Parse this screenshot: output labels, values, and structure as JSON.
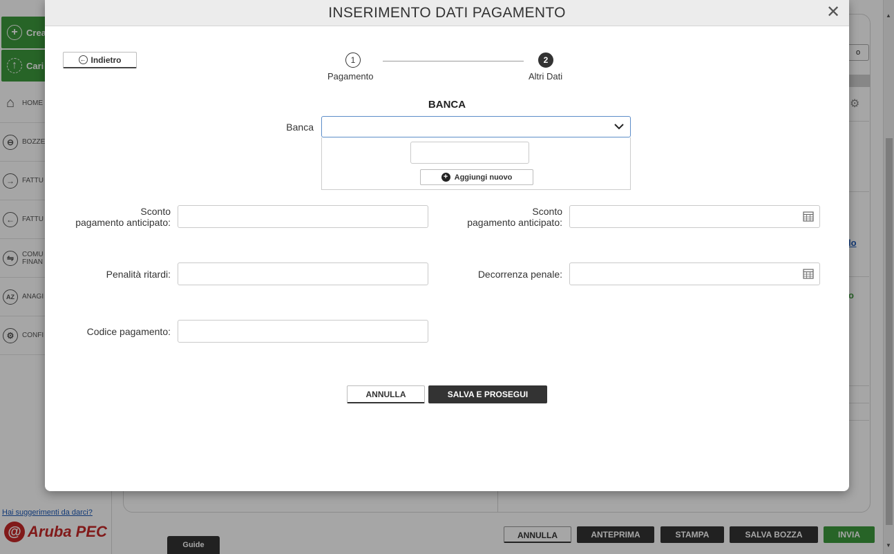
{
  "background": {
    "sidebar": {
      "create_label": "Crea",
      "upload_label": "Cari",
      "items": [
        {
          "label": "HOME",
          "icon": "home-icon"
        },
        {
          "label": "BOZZE",
          "icon": "drafts-icon"
        },
        {
          "label": "FATTU",
          "icon": "arrow-right-circle-icon"
        },
        {
          "label": "FATTU",
          "icon": "arrow-left-circle-icon"
        },
        {
          "label": "COMU\nFINAN",
          "icon": "exchange-icon"
        },
        {
          "label": "ANAGI",
          "icon": "az-icon"
        },
        {
          "label": "CONFI",
          "icon": "gear-icon"
        }
      ],
      "suggestion_link": "Hai suggerimenti da darci?",
      "logo_text": "Aruba PEC"
    },
    "guide_tab": "Guide",
    "bottom_buttons": {
      "annulla": "ANNULLA",
      "anteprima": "ANTEPRIMA",
      "stampa": "STAMPA",
      "salva_bozza": "SALVA BOZZA",
      "invia": "INVIA"
    },
    "right_panel": {
      "link_fragment": "lo",
      "green_fragment": "o"
    }
  },
  "modal": {
    "title": "INSERIMENTO DATI PAGAMENTO",
    "close_glyph": "✕",
    "back_label": "Indietro",
    "steps": [
      {
        "number": "1",
        "label": "Pagamento",
        "state": "done"
      },
      {
        "number": "2",
        "label": "Altri Dati",
        "state": "active"
      }
    ],
    "section_title": "BANCA",
    "banca": {
      "label": "Banca",
      "selected_value": "",
      "search_value": "",
      "add_new_label": "Aggiungi nuovo"
    },
    "fields": {
      "sconto_left": {
        "label_line1": "Sconto",
        "label_line2": "pagamento anticipato:",
        "value": ""
      },
      "sconto_right": {
        "label_line1": "Sconto",
        "label_line2": "pagamento anticipato:",
        "value": ""
      },
      "penalita": {
        "label": "Penalità ritardi:",
        "value": ""
      },
      "decorrenza": {
        "label": "Decorrenza penale:",
        "value": ""
      },
      "codice": {
        "label": "Codice pagamento:",
        "value": ""
      }
    },
    "actions": {
      "cancel_label": "ANNULLA",
      "save_label": "SALVA E PROSEGUI"
    }
  },
  "colors": {
    "accent_green": "#3c9a3c",
    "dark_button": "#333333",
    "focus_border": "#5b8cc8",
    "link_blue": "#1a57b5",
    "logo_red": "#c62828"
  }
}
